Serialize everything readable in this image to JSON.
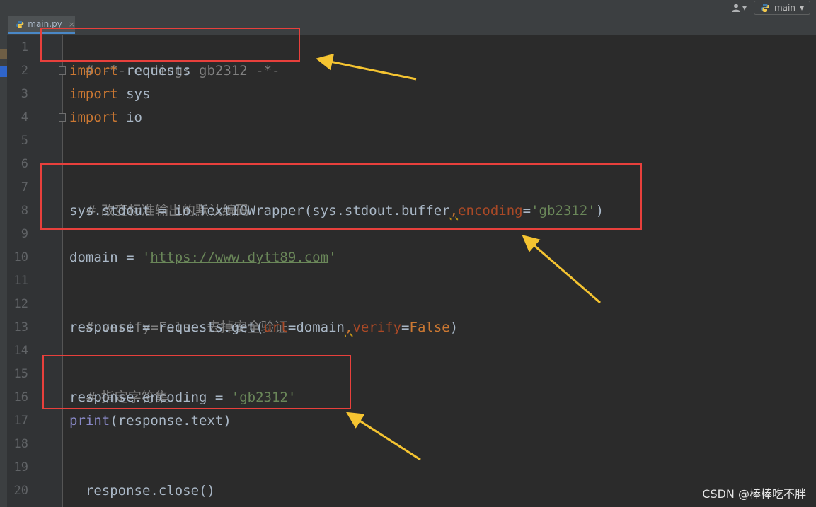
{
  "header": {
    "branch": "main"
  },
  "editor": {
    "tab": {
      "filename": "main.py",
      "close_glyph": "×"
    },
    "line_numbers": [
      "1",
      "2",
      "3",
      "4",
      "5",
      "6",
      "7",
      "8",
      "9",
      "10",
      "11",
      "12",
      "13",
      "14",
      "15",
      "16",
      "17",
      "18",
      "19",
      "20"
    ],
    "lines": {
      "l1_comment": "# -*- coding: gb2312 -*-",
      "l2_kw": "import",
      "l2_rest": " requests",
      "l3_kw": "import",
      "l3_rest": " sys",
      "l4_kw": "import",
      "l4_rest": " io",
      "l7_comment": "# 改变标准输出的默认编码",
      "l8_a": "sys.stdout = io.TextIOWrapper(sys.stdout.buffer",
      "l8_comma": ",",
      "l8_param": "encoding",
      "l8_eq": "=",
      "l8_str": "'gb2312'",
      "l8_close": ")",
      "l10_a": "domain = ",
      "l10_q1": "'",
      "l10_url": "https://www.dytt89.com",
      "l10_q2": "'",
      "l12_comment": "# verify=False 去掉安全验证",
      "l13_a": "response = requests.get(",
      "l13_param1": "url",
      "l13_b": "=domain",
      "l13_comma": ",",
      "l13_param2": "verify",
      "l13_eq": "=",
      "l13_kw": "False",
      "l13_close": ")",
      "l15_comment": "# 指定字符集",
      "l16_a": "response.encoding = ",
      "l16_str": "'gb2312'",
      "l17_builtin": "print",
      "l17_rest": "(response.text)",
      "l19": "response.close()"
    }
  },
  "watermark": "CSDN @棒棒吃不胖",
  "colors": {
    "annotation_box": "#e8403c",
    "annotation_arrow": "#f5c431"
  }
}
